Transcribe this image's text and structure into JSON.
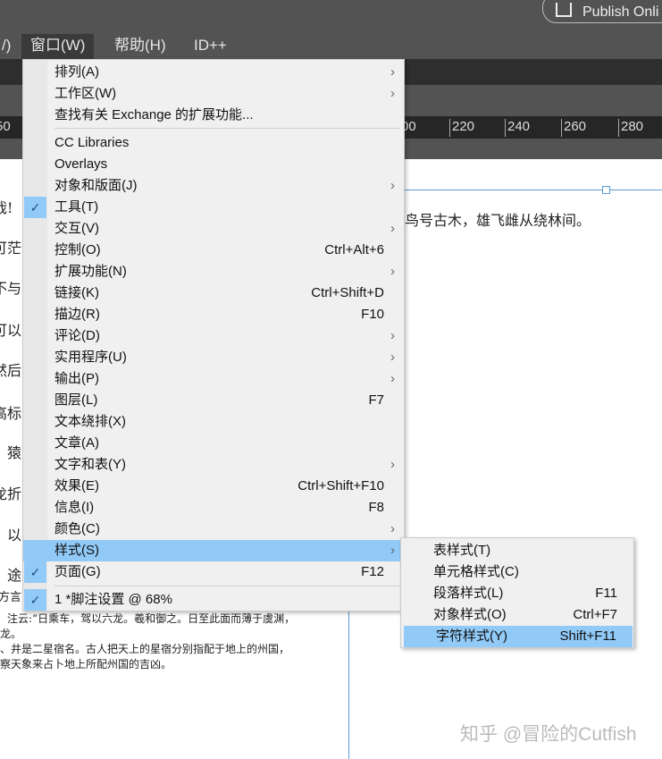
{
  "topbar": {
    "publish_label": "Publish Onli"
  },
  "menubar": {
    "items": [
      "/)",
      "窗口(W)",
      "帮助(H)",
      "ID++"
    ]
  },
  "ruler": {
    "ticks": [
      "50",
      "00",
      "220",
      "240",
      "260",
      "280"
    ]
  },
  "document": {
    "left_chars": [
      "哉!",
      "可茫",
      "不与",
      "可以",
      "然后",
      "高标",
      "猿",
      "龙折",
      "以",
      "途",
      "方言"
    ],
    "right_line": "鸟号古木，雄飞雌从绕林间。",
    "footnotes": [
      "注云:“日乘车，驾以六龙。羲和御之。日至此面而薄于虞渊，",
      "龙。",
      "、井是二星宿名。古人把天上的星宿分别指配于地上的州国，",
      "察天象来占卜地上所配州国的吉凶。"
    ]
  },
  "menu": {
    "items": [
      {
        "label": "排列(A)",
        "submenu": true
      },
      {
        "label": "工作区(W)",
        "submenu": true
      },
      {
        "label": "查找有关 Exchange 的扩展功能..."
      },
      {
        "label": "CC Libraries"
      },
      {
        "label": "Overlays"
      },
      {
        "label": "对象和版面(J)",
        "submenu": true
      },
      {
        "label": "工具(T)",
        "checked": true
      },
      {
        "label": "交互(V)",
        "submenu": true
      },
      {
        "label": "控制(O)",
        "shortcut": "Ctrl+Alt+6"
      },
      {
        "label": "扩展功能(N)",
        "submenu": true
      },
      {
        "label": "链接(K)",
        "shortcut": "Ctrl+Shift+D"
      },
      {
        "label": "描边(R)",
        "shortcut": "F10"
      },
      {
        "label": "评论(D)",
        "submenu": true
      },
      {
        "label": "实用程序(U)",
        "submenu": true
      },
      {
        "label": "输出(P)",
        "submenu": true
      },
      {
        "label": "图层(L)",
        "shortcut": "F7"
      },
      {
        "label": "文本绕排(X)"
      },
      {
        "label": "文章(A)"
      },
      {
        "label": "文字和表(Y)",
        "submenu": true
      },
      {
        "label": "效果(E)",
        "shortcut": "Ctrl+Shift+F10"
      },
      {
        "label": "信息(I)",
        "shortcut": "F8"
      },
      {
        "label": "颜色(C)",
        "submenu": true
      },
      {
        "label": "样式(S)",
        "submenu": true,
        "highlighted": true
      },
      {
        "label": "页面(G)",
        "shortcut": "F12",
        "checked": true
      },
      {
        "label": "1 *脚注设置 @ 68%",
        "checked": true
      }
    ]
  },
  "submenu": {
    "items": [
      {
        "label": "表样式(T)"
      },
      {
        "label": "单元格样式(C)"
      },
      {
        "label": "段落样式(L)",
        "shortcut": "F11"
      },
      {
        "label": "对象样式(O)",
        "shortcut": "Ctrl+F7"
      },
      {
        "label": "字符样式(Y)",
        "shortcut": "Shift+F11",
        "highlighted": true
      }
    ]
  },
  "watermark": "知乎 @冒险的Cutfish",
  "icons": {
    "check": "✓",
    "arrow": "›"
  }
}
